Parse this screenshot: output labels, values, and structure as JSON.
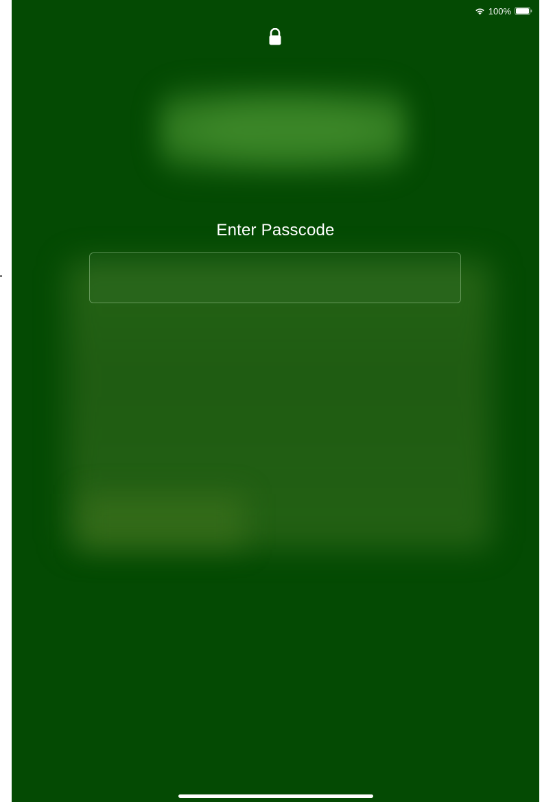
{
  "status_bar": {
    "battery_text": "100%",
    "wifi_icon": "wifi-icon",
    "battery_icon": "battery-icon"
  },
  "lock_screen": {
    "lock_icon": "lock-icon",
    "title": "Enter Passcode",
    "passcode_value": "",
    "passcode_placeholder": ""
  },
  "colors": {
    "background": "#044a03",
    "text": "#ffffff"
  }
}
